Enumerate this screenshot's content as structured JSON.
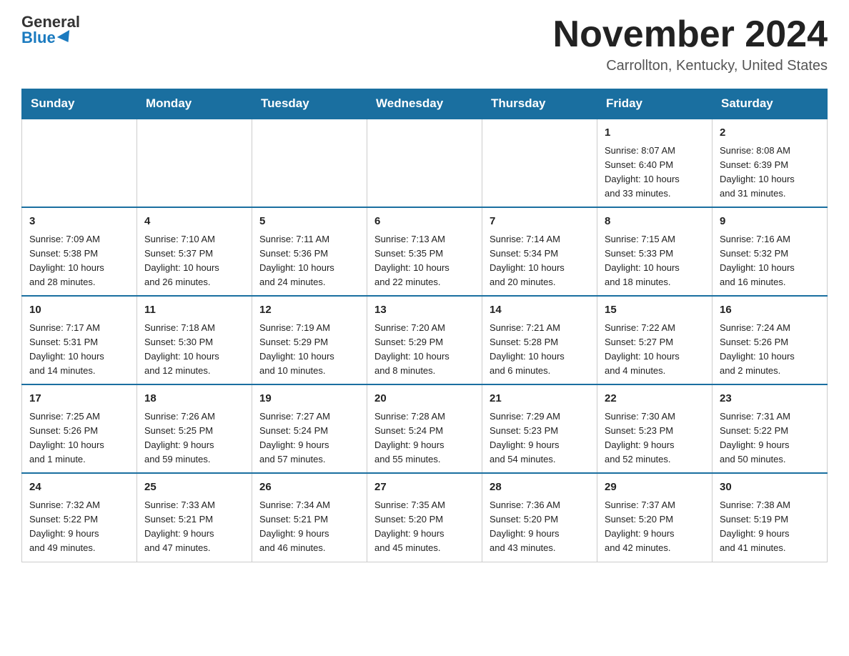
{
  "header": {
    "logo_general": "General",
    "logo_blue": "Blue",
    "month_title": "November 2024",
    "location": "Carrollton, Kentucky, United States"
  },
  "days_of_week": [
    "Sunday",
    "Monday",
    "Tuesday",
    "Wednesday",
    "Thursday",
    "Friday",
    "Saturday"
  ],
  "weeks": [
    {
      "days": [
        {
          "number": "",
          "info": ""
        },
        {
          "number": "",
          "info": ""
        },
        {
          "number": "",
          "info": ""
        },
        {
          "number": "",
          "info": ""
        },
        {
          "number": "",
          "info": ""
        },
        {
          "number": "1",
          "info": "Sunrise: 8:07 AM\nSunset: 6:40 PM\nDaylight: 10 hours\nand 33 minutes."
        },
        {
          "number": "2",
          "info": "Sunrise: 8:08 AM\nSunset: 6:39 PM\nDaylight: 10 hours\nand 31 minutes."
        }
      ]
    },
    {
      "days": [
        {
          "number": "3",
          "info": "Sunrise: 7:09 AM\nSunset: 5:38 PM\nDaylight: 10 hours\nand 28 minutes."
        },
        {
          "number": "4",
          "info": "Sunrise: 7:10 AM\nSunset: 5:37 PM\nDaylight: 10 hours\nand 26 minutes."
        },
        {
          "number": "5",
          "info": "Sunrise: 7:11 AM\nSunset: 5:36 PM\nDaylight: 10 hours\nand 24 minutes."
        },
        {
          "number": "6",
          "info": "Sunrise: 7:13 AM\nSunset: 5:35 PM\nDaylight: 10 hours\nand 22 minutes."
        },
        {
          "number": "7",
          "info": "Sunrise: 7:14 AM\nSunset: 5:34 PM\nDaylight: 10 hours\nand 20 minutes."
        },
        {
          "number": "8",
          "info": "Sunrise: 7:15 AM\nSunset: 5:33 PM\nDaylight: 10 hours\nand 18 minutes."
        },
        {
          "number": "9",
          "info": "Sunrise: 7:16 AM\nSunset: 5:32 PM\nDaylight: 10 hours\nand 16 minutes."
        }
      ]
    },
    {
      "days": [
        {
          "number": "10",
          "info": "Sunrise: 7:17 AM\nSunset: 5:31 PM\nDaylight: 10 hours\nand 14 minutes."
        },
        {
          "number": "11",
          "info": "Sunrise: 7:18 AM\nSunset: 5:30 PM\nDaylight: 10 hours\nand 12 minutes."
        },
        {
          "number": "12",
          "info": "Sunrise: 7:19 AM\nSunset: 5:29 PM\nDaylight: 10 hours\nand 10 minutes."
        },
        {
          "number": "13",
          "info": "Sunrise: 7:20 AM\nSunset: 5:29 PM\nDaylight: 10 hours\nand 8 minutes."
        },
        {
          "number": "14",
          "info": "Sunrise: 7:21 AM\nSunset: 5:28 PM\nDaylight: 10 hours\nand 6 minutes."
        },
        {
          "number": "15",
          "info": "Sunrise: 7:22 AM\nSunset: 5:27 PM\nDaylight: 10 hours\nand 4 minutes."
        },
        {
          "number": "16",
          "info": "Sunrise: 7:24 AM\nSunset: 5:26 PM\nDaylight: 10 hours\nand 2 minutes."
        }
      ]
    },
    {
      "days": [
        {
          "number": "17",
          "info": "Sunrise: 7:25 AM\nSunset: 5:26 PM\nDaylight: 10 hours\nand 1 minute."
        },
        {
          "number": "18",
          "info": "Sunrise: 7:26 AM\nSunset: 5:25 PM\nDaylight: 9 hours\nand 59 minutes."
        },
        {
          "number": "19",
          "info": "Sunrise: 7:27 AM\nSunset: 5:24 PM\nDaylight: 9 hours\nand 57 minutes."
        },
        {
          "number": "20",
          "info": "Sunrise: 7:28 AM\nSunset: 5:24 PM\nDaylight: 9 hours\nand 55 minutes."
        },
        {
          "number": "21",
          "info": "Sunrise: 7:29 AM\nSunset: 5:23 PM\nDaylight: 9 hours\nand 54 minutes."
        },
        {
          "number": "22",
          "info": "Sunrise: 7:30 AM\nSunset: 5:23 PM\nDaylight: 9 hours\nand 52 minutes."
        },
        {
          "number": "23",
          "info": "Sunrise: 7:31 AM\nSunset: 5:22 PM\nDaylight: 9 hours\nand 50 minutes."
        }
      ]
    },
    {
      "days": [
        {
          "number": "24",
          "info": "Sunrise: 7:32 AM\nSunset: 5:22 PM\nDaylight: 9 hours\nand 49 minutes."
        },
        {
          "number": "25",
          "info": "Sunrise: 7:33 AM\nSunset: 5:21 PM\nDaylight: 9 hours\nand 47 minutes."
        },
        {
          "number": "26",
          "info": "Sunrise: 7:34 AM\nSunset: 5:21 PM\nDaylight: 9 hours\nand 46 minutes."
        },
        {
          "number": "27",
          "info": "Sunrise: 7:35 AM\nSunset: 5:20 PM\nDaylight: 9 hours\nand 45 minutes."
        },
        {
          "number": "28",
          "info": "Sunrise: 7:36 AM\nSunset: 5:20 PM\nDaylight: 9 hours\nand 43 minutes."
        },
        {
          "number": "29",
          "info": "Sunrise: 7:37 AM\nSunset: 5:20 PM\nDaylight: 9 hours\nand 42 minutes."
        },
        {
          "number": "30",
          "info": "Sunrise: 7:38 AM\nSunset: 5:19 PM\nDaylight: 9 hours\nand 41 minutes."
        }
      ]
    }
  ]
}
